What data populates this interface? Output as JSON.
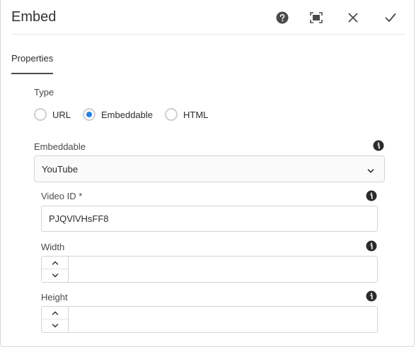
{
  "dialog": {
    "title": "Embed"
  },
  "tabs": [
    {
      "label": "Properties"
    }
  ],
  "type_field": {
    "label": "Type",
    "options": [
      {
        "label": "URL",
        "checked": false
      },
      {
        "label": "Embeddable",
        "checked": true
      },
      {
        "label": "HTML",
        "checked": false
      }
    ]
  },
  "embeddable_field": {
    "label": "Embeddable",
    "selected": "YouTube"
  },
  "video_id_field": {
    "label": "Video ID *",
    "value": "PJQVlVHsFF8"
  },
  "width_field": {
    "label": "Width",
    "value": ""
  },
  "height_field": {
    "label": "Height",
    "value": ""
  },
  "icons": {
    "help": "help-icon",
    "fullscreen": "fullscreen-icon",
    "close": "close-icon",
    "confirm": "checkmark-icon",
    "info": "info-icon",
    "chevron": "chevron-down-icon"
  },
  "colors": {
    "accent": "#2680eb",
    "icon": "#4b4b4b",
    "border": "#d3d3d3"
  }
}
